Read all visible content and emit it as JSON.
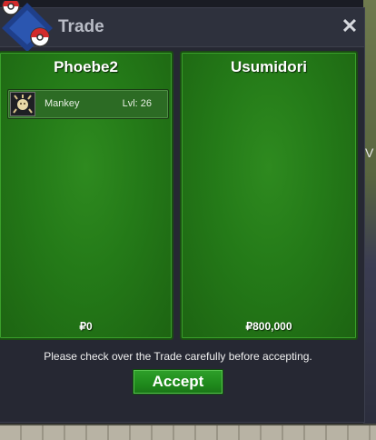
{
  "window": {
    "title": "Trade",
    "close_label": "✕"
  },
  "background": {
    "edge_text": "V"
  },
  "left_panel": {
    "name": "Phoebe2",
    "money": "₽0",
    "pokemon": [
      {
        "name": "Mankey",
        "level": "Lvl: 26",
        "icon": "mankey-icon"
      }
    ]
  },
  "right_panel": {
    "name": "Usumidori",
    "money": "₽800,000"
  },
  "footer": {
    "message": "Please check over the Trade carefully before accepting.",
    "accept_label": "Accept"
  },
  "colors": {
    "panel_green": "#247a18",
    "button_green": "#1f8a1c",
    "window_bg": "#262833"
  }
}
